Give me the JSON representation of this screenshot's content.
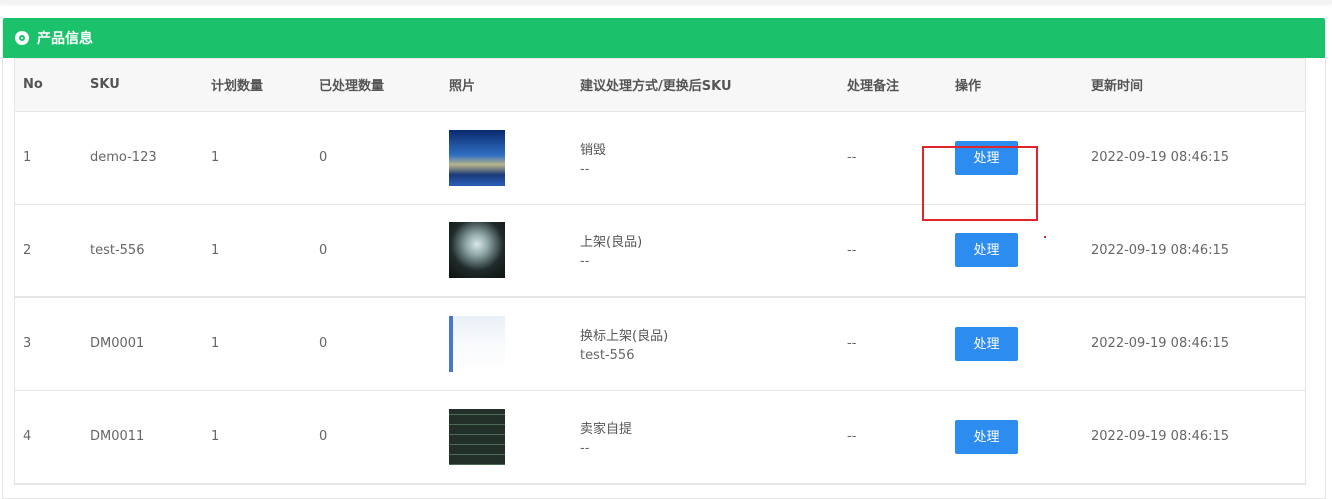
{
  "panel": {
    "title": "产品信息",
    "icon": "wordpress-icon"
  },
  "table": {
    "headers": [
      "No",
      "SKU",
      "计划数量",
      "已处理数量",
      "照片",
      "建议处理方式/更换后SKU",
      "处理备注",
      "操作",
      "更新时间"
    ],
    "rows": [
      {
        "no": "1",
        "sku": "demo-123",
        "plan": "1",
        "processed": "0",
        "photo": "photo-thumbnail",
        "suggest": "销毁",
        "replace_sku": "--",
        "remark": "--",
        "action": "处理",
        "time": "2022-09-19 08:46:15"
      },
      {
        "no": "2",
        "sku": "test-556",
        "plan": "1",
        "processed": "0",
        "photo": "photo-thumbnail",
        "suggest": "上架(良品)",
        "replace_sku": "--",
        "remark": "--",
        "action": "处理",
        "time": "2022-09-19 08:46:15"
      },
      {
        "no": "3",
        "sku": "DM0001",
        "plan": "1",
        "processed": "0",
        "photo": "photo-thumbnail",
        "suggest": "换标上架(良品)",
        "replace_sku": "test-556",
        "remark": "--",
        "action": "处理",
        "time": "2022-09-19 08:46:15"
      },
      {
        "no": "4",
        "sku": "DM0011",
        "plan": "1",
        "processed": "0",
        "photo": "photo-thumbnail",
        "suggest": "卖家自提",
        "replace_sku": "--",
        "remark": "--",
        "action": "处理",
        "time": "2022-09-19 08:46:15"
      }
    ]
  },
  "colors": {
    "header_green": "#1cc26b",
    "button_blue": "#2d8cf0",
    "highlight_red": "#e0262b"
  }
}
